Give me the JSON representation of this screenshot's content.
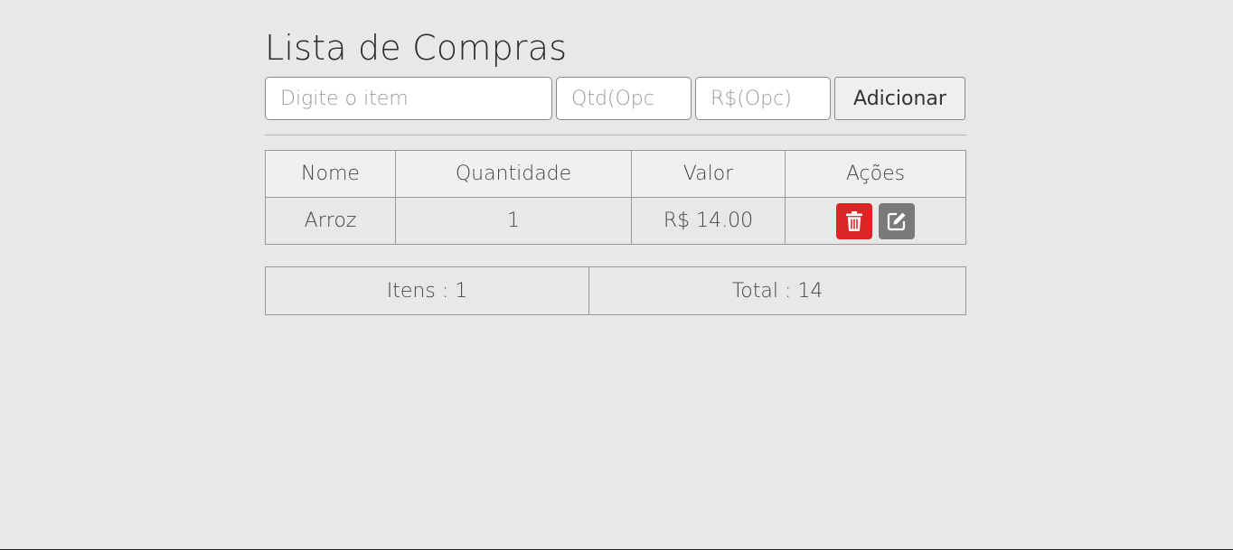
{
  "page": {
    "title": "Lista de Compras"
  },
  "form": {
    "item_placeholder": "Digite o item",
    "qtd_placeholder": "Qtd(Opc",
    "valor_placeholder": "R$(Opc)",
    "add_label": "Adicionar"
  },
  "table": {
    "headers": [
      "Nome",
      "Quantidade",
      "Valor",
      "Ações"
    ],
    "rows": [
      {
        "nome": "Arroz",
        "quantidade": "1",
        "valor": "R$ 14.00"
      }
    ],
    "actions": {
      "delete_icon": "trash-icon",
      "edit_icon": "edit-icon"
    }
  },
  "summary": {
    "itens": "Itens : 1",
    "total": "Total : 14"
  },
  "colors": {
    "delete": "#dc2626",
    "edit": "#7a7a7a",
    "background": "#e8e8e8"
  }
}
